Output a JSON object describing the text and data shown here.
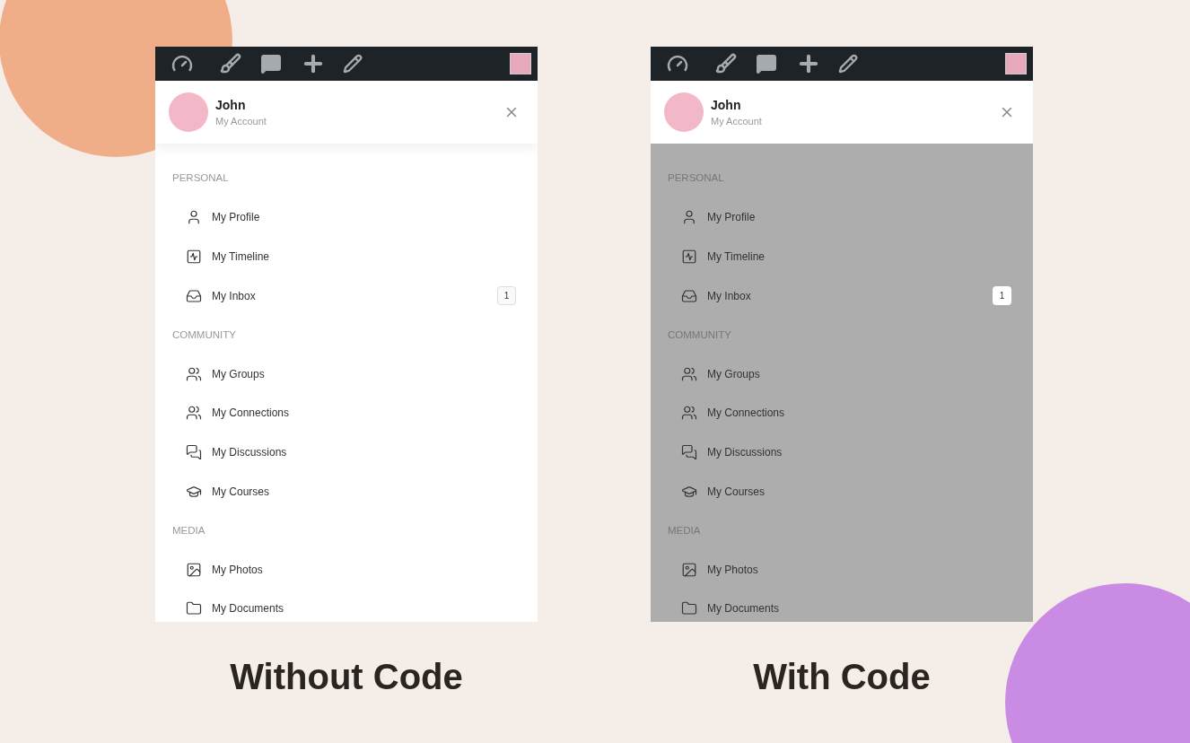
{
  "panels": [
    {
      "caption": "Without Code",
      "dimmed": false,
      "user": {
        "name": "John",
        "subtitle": "My Account"
      },
      "sections": [
        {
          "title": "PERSONAL",
          "items": [
            {
              "label": "My Profile"
            },
            {
              "label": "My Timeline"
            },
            {
              "label": "My Inbox",
              "badge": "1"
            }
          ]
        },
        {
          "title": "COMMUNITY",
          "items": [
            {
              "label": "My Groups"
            },
            {
              "label": "My Connections"
            },
            {
              "label": "My Discussions"
            },
            {
              "label": "My Courses"
            }
          ]
        },
        {
          "title": "MEDIA",
          "items": [
            {
              "label": "My Photos"
            },
            {
              "label": "My Documents"
            }
          ]
        }
      ]
    },
    {
      "caption": "With Code",
      "dimmed": true,
      "user": {
        "name": "John",
        "subtitle": "My Account"
      },
      "sections": [
        {
          "title": "PERSONAL",
          "items": [
            {
              "label": "My Profile"
            },
            {
              "label": "My Timeline"
            },
            {
              "label": "My Inbox",
              "badge": "1"
            }
          ]
        },
        {
          "title": "COMMUNITY",
          "items": [
            {
              "label": "My Groups"
            },
            {
              "label": "My Connections"
            },
            {
              "label": "My Discussions"
            },
            {
              "label": "My Courses"
            }
          ]
        },
        {
          "title": "MEDIA",
          "items": [
            {
              "label": "My Photos"
            },
            {
              "label": "My Documents"
            }
          ]
        }
      ]
    }
  ]
}
